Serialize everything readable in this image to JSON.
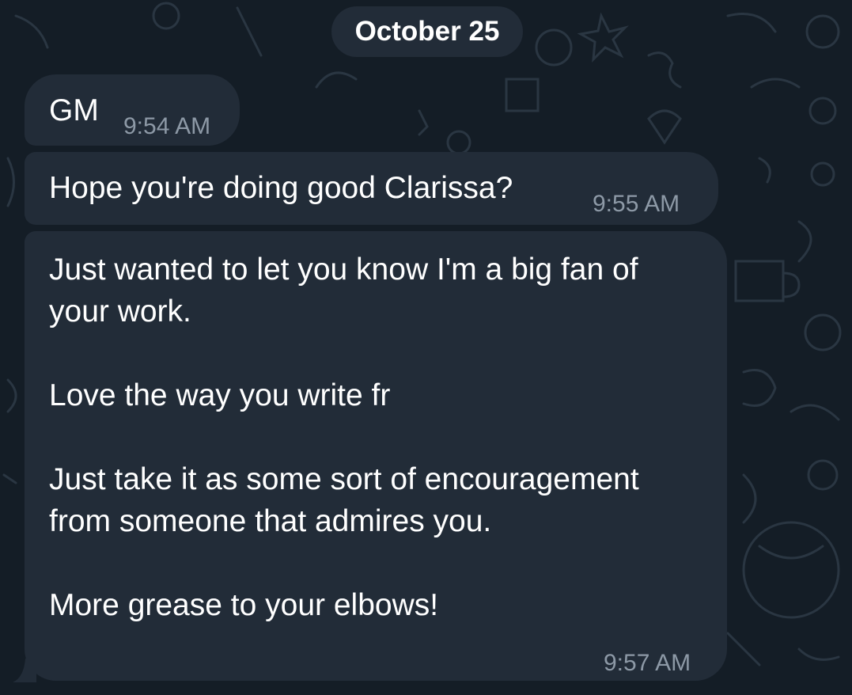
{
  "date_separator": "October 25",
  "messages": [
    {
      "text": "GM",
      "time": "9:54 AM"
    },
    {
      "text": "Hope you're doing good Clarissa?",
      "time": "9:55 AM"
    },
    {
      "text": "Just wanted to let you know I'm a big fan of your work.\n\nLove the way you write fr\n\nJust take it as some sort of encouragement from someone that admires you.\n\nMore grease to your elbows!",
      "time": "9:57 AM"
    }
  ],
  "colors": {
    "background": "#141d26",
    "bubble": "#222c38",
    "text": "#ffffff",
    "timestamp": "#8d99a6"
  },
  "icons": [
    "doodle-pattern-background"
  ]
}
